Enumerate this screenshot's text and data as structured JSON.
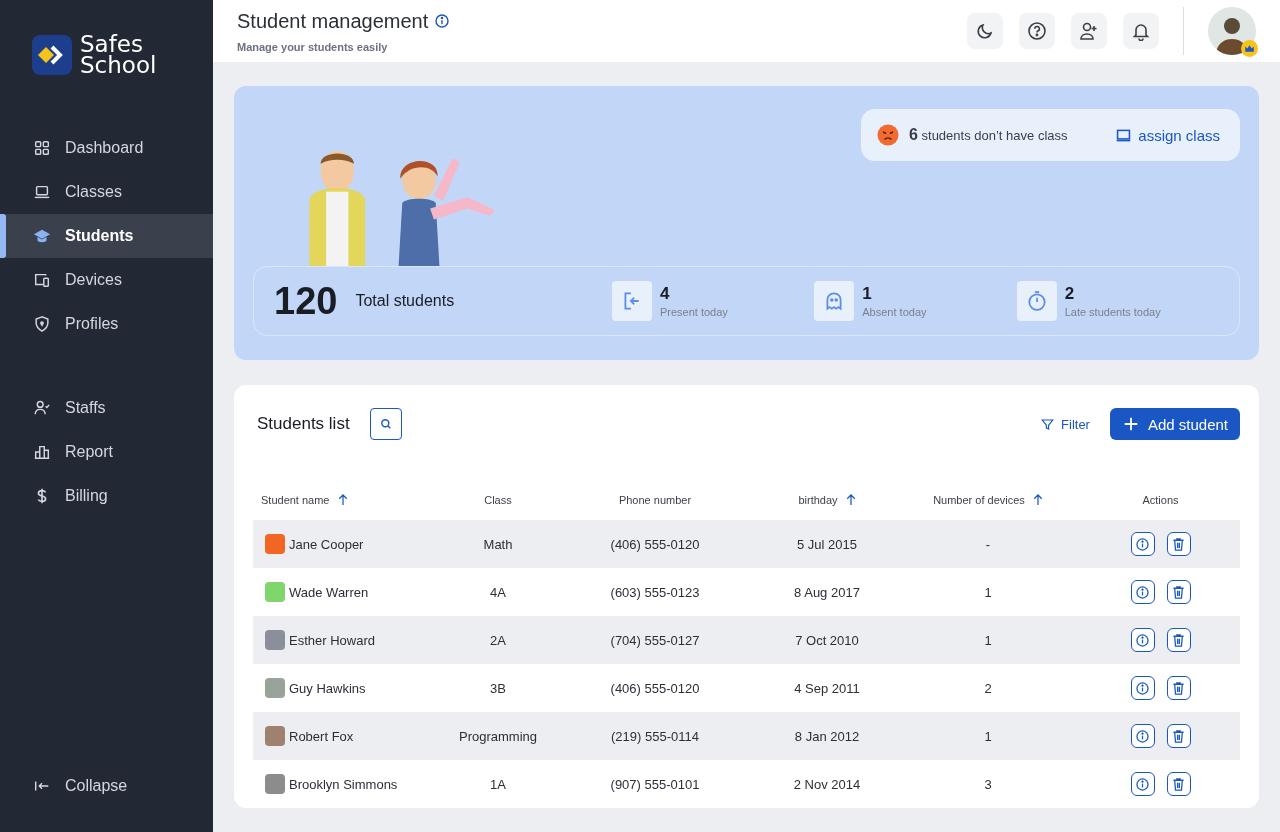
{
  "brand": {
    "line1": "Safes",
    "line2": "School"
  },
  "sidebar": {
    "items": [
      {
        "label": "Dashboard",
        "selected": false
      },
      {
        "label": "Classes",
        "selected": false
      },
      {
        "label": "Students",
        "selected": true
      },
      {
        "label": "Devices",
        "selected": false
      },
      {
        "label": "Profiles",
        "selected": false
      }
    ],
    "items2": [
      {
        "label": "Staffs",
        "selected": false
      },
      {
        "label": "Report",
        "selected": false
      },
      {
        "label": "Billing",
        "selected": false
      }
    ],
    "collapse": "Collapse"
  },
  "header": {
    "title": "Student management",
    "subtitle": "Manage your students easily"
  },
  "banner": {
    "notice": {
      "count": "6",
      "text": "students don’t have class",
      "link": "assign class"
    },
    "total": {
      "value": "120",
      "label": "Total students"
    },
    "stats": [
      {
        "value": "4",
        "label": "Present today"
      },
      {
        "value": "1",
        "label": "Absent today"
      },
      {
        "value": "2",
        "label": "Late students today"
      }
    ]
  },
  "students_list": {
    "title": "Students list",
    "filter": "Filter",
    "add": "Add student",
    "columns": [
      {
        "label": "Student name",
        "sortable": true
      },
      {
        "label": "Class",
        "sortable": false
      },
      {
        "label": "Phone number",
        "sortable": false
      },
      {
        "label": "birthday",
        "sortable": true
      },
      {
        "label": "Number of devices",
        "sortable": true
      },
      {
        "label": "Actions",
        "sortable": false
      }
    ],
    "rows": [
      {
        "name": "Jane Cooper",
        "class": "Math",
        "phone": "(406) 555-0120",
        "birthday": "5 Jul 2015",
        "devices": "-"
      },
      {
        "name": "Wade Warren",
        "class": "4A",
        "phone": "(603) 555-0123",
        "birthday": "8 Aug 2017",
        "devices": "1"
      },
      {
        "name": "Esther Howard",
        "class": "2A",
        "phone": "(704) 555-0127",
        "birthday": "7 Oct 2010",
        "devices": "1"
      },
      {
        "name": "Guy Hawkins",
        "class": "3B",
        "phone": "(406) 555-0120",
        "birthday": "4 Sep 2011",
        "devices": "2"
      },
      {
        "name": "Robert Fox",
        "class": "Programming",
        "phone": "(219) 555-0114",
        "birthday": "8 Jan 2012",
        "devices": "1"
      },
      {
        "name": "Brooklyn Simmons",
        "class": "1A",
        "phone": "(907) 555-0101",
        "birthday": "2 Nov 2014",
        "devices": "3"
      }
    ]
  }
}
